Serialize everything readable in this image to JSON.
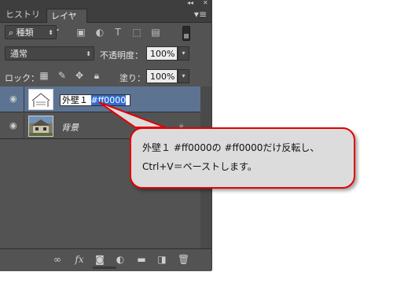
{
  "panel": {
    "collapse_icon": "double-chevron",
    "close_icon": "close-x",
    "tabs": [
      {
        "label": "ヒストリー",
        "active": false
      },
      {
        "label": "レイヤー",
        "active": true
      }
    ],
    "menu_icon": "panel-menu-icon"
  },
  "filter": {
    "kind_label": "種類"
  },
  "blend": {
    "mode": "通常",
    "opacity_label": "不透明度：",
    "opacity_value": "100%"
  },
  "lock": {
    "label": "ロック：",
    "fill_label": "塗り：",
    "fill_value": "100%"
  },
  "layers": [
    {
      "name_prefix": "外壁１",
      "name_selected": "#ff0000",
      "selected": true,
      "visible": true
    },
    {
      "name": "背景",
      "selected": false,
      "visible": true,
      "locked": true
    }
  ],
  "callout": {
    "line1": "外壁１ #ff0000の #ff0000だけ反転し、",
    "line2": "Ctrl+V＝ペーストします。",
    "border_color": "#e40000"
  },
  "colors": {
    "panel_bg": "#535353",
    "selected_row": "#5c7392",
    "selection_highlight": "#2f6bd0"
  }
}
